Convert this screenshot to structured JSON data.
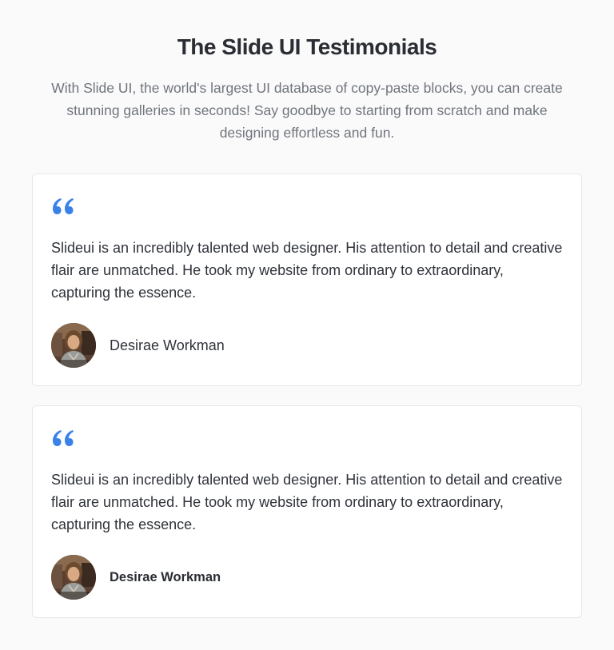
{
  "header": {
    "title": "The Slide UI Testimonials",
    "subtitle": "With Slide UI, the world's largest UI database of copy-paste blocks, you can create stunning galleries in seconds! Say goodbye to starting from scratch and make designing effortless and fun."
  },
  "testimonials": [
    {
      "quote": "Slideui is an incredibly talented web designer. His attention to detail and creative flair are unmatched. He took my website from ordinary to extraordinary, capturing the essence.",
      "author": "Desirae Workman"
    },
    {
      "quote": "Slideui is an incredibly talented web designer. His attention to detail and creative flair are unmatched. He took my website from ordinary to extraordinary, capturing the essence.",
      "author": "Desirae Workman"
    }
  ],
  "colors": {
    "accent": "#3b82e8",
    "background": "#fafafa",
    "card": "#ffffff",
    "border": "#e6e7ea"
  },
  "icons": {
    "quote": "quote-icon",
    "avatar": "avatar"
  }
}
